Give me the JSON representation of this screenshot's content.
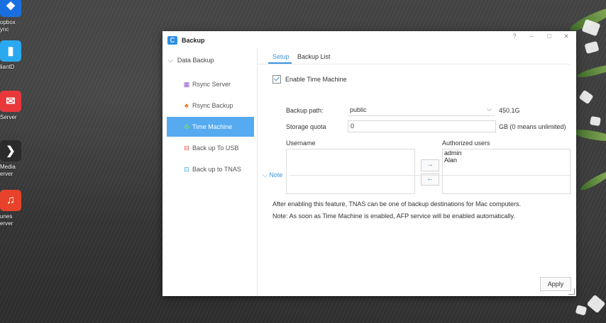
{
  "desktop": {
    "icons": [
      {
        "label_lines": [
          "opbox",
          "ync"
        ],
        "color": "#1a6fe0",
        "glyph": "❖",
        "icon": "dropbox-icon"
      },
      {
        "label_lines": [
          "liantD"
        ],
        "color": "#2aa9f0",
        "glyph": "▮",
        "icon": "download-icon"
      },
      {
        "label_lines": [
          "Server"
        ],
        "color": "#e8383a",
        "glyph": "✉",
        "icon": "mail-icon"
      },
      {
        "label_lines": [
          "Media",
          "erver"
        ],
        "color": "#2b2b2b",
        "glyph": "❯",
        "icon": "plex-icon"
      },
      {
        "label_lines": [
          "unes",
          "erver"
        ],
        "color": "#e8422a",
        "glyph": "♫",
        "icon": "itunes-icon"
      }
    ]
  },
  "window": {
    "title": "Backup",
    "controls": {
      "help": "?",
      "minimize": "–",
      "maximize": "□",
      "close": "✕"
    }
  },
  "sidebar": {
    "group": "Data Backup",
    "items": [
      {
        "label": "Rsync Server",
        "icon": "rsync-server-icon",
        "glyph": "▦",
        "color": "#8b5cc7"
      },
      {
        "label": "Rsync Backup",
        "icon": "rsync-backup-icon",
        "glyph": "♣",
        "color": "#e8702a"
      },
      {
        "label": "Time Machine",
        "icon": "time-machine-icon",
        "glyph": "♻",
        "color": "#6cc04a"
      },
      {
        "label": "Back up To USB",
        "icon": "usb-backup-icon",
        "glyph": "⊟",
        "color": "#e84a4a"
      },
      {
        "label": "Back up to TNAS",
        "icon": "tnas-backup-icon",
        "glyph": "⊡",
        "color": "#2aa0d8"
      }
    ],
    "active_index": 2
  },
  "tabs": [
    {
      "label": "Setup"
    },
    {
      "label": "Backup List"
    }
  ],
  "setup": {
    "enable_label": "Enable Time Machine",
    "enabled": true,
    "backup_path_label": "Backup path:",
    "backup_path_value": "public",
    "backup_path_size": "450.1G",
    "quota_label": "Storage quota",
    "quota_value": "0",
    "quota_unit": "GB (0 means unlimited)",
    "username_label": "Username",
    "authorized_label": "Authorized users",
    "usernames": [],
    "authorized_users": [
      "admin",
      "Alan"
    ],
    "move_right": "→",
    "move_left": "←"
  },
  "note": {
    "title": "Note",
    "lines": [
      "After enabling this feature, TNAS can be one of backup destinations for Mac computers.",
      "Note: As soon as Time Machine is enabled, AFP service will be enabled automatically."
    ]
  },
  "apply_label": "Apply"
}
